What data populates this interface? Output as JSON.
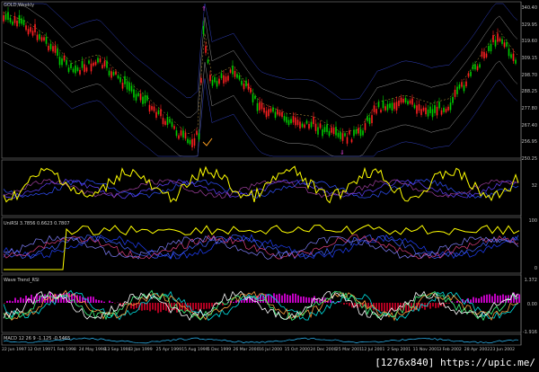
{
  "chart_title": "GOLD,Weekly",
  "main_pane": {
    "price_axis": [
      "340.40",
      "329.95",
      "319.60",
      "309.15",
      "298.70",
      "288.25",
      "277.80",
      "267.40",
      "256.95",
      "250.25"
    ]
  },
  "pane2": {
    "axis": [
      "32"
    ]
  },
  "pane3": {
    "label": "UniRSI 3.7856 0.6623 0.7807",
    "axis": [
      "100",
      "0"
    ]
  },
  "pane4": {
    "label": "Wave Trend_RSI",
    "axis": [
      "1.372",
      "0.00",
      "-1.916"
    ]
  },
  "pane5": {
    "label": "MACD 12 26 9 -1.125 -0.5465"
  },
  "date_axis": [
    "22 Jun 1997",
    "12 Oct 1997",
    "1 Feb 1998",
    "24 May 1998",
    "13 Sep 1998",
    "3 Jan 1999",
    "25 Apr 1999",
    "15 Aug 1999",
    "5 Dec 1999",
    "26 Mar 2000",
    "16 Jul 2000",
    "15 Oct 2000",
    "24 Dec 2000",
    "25 Mar 2001",
    "12 Jul 2001",
    "2 Sep 2001",
    "11 Nov 2001",
    "3 Feb 2002",
    "28 Apr 2002",
    "23 Jun 2002"
  ],
  "watermark": "[1276x840] https://upic.me/",
  "colors": {
    "background": "#000000",
    "bull_candle": "#00cc00",
    "bear_candle": "#ff2020",
    "rsi_line": "#ffff00",
    "band_line": "#3050ff",
    "wave_pos": "#c000c0",
    "wave_neg": "#b00020",
    "wave_line": "#00e0e0"
  }
}
